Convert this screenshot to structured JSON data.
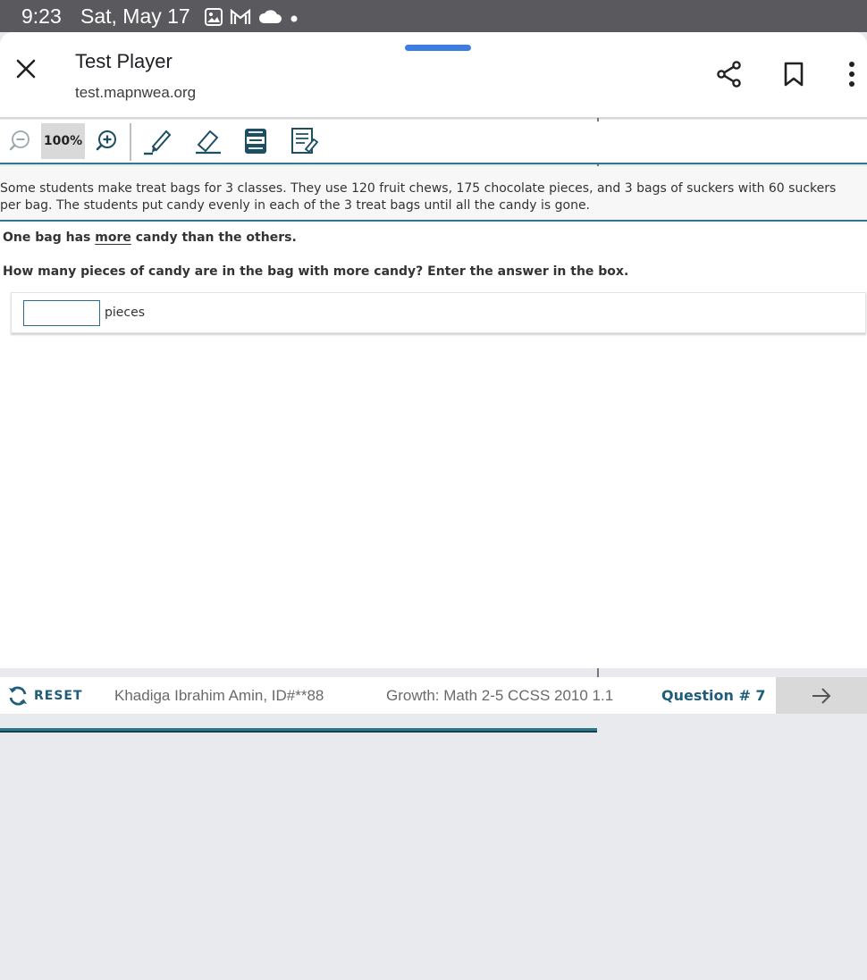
{
  "status_bar": {
    "time": "9:23",
    "date": "Sat, May 17",
    "icons": [
      "image-icon",
      "gmail-icon",
      "cloud-icon",
      "dot-icon"
    ]
  },
  "browser": {
    "title": "Test Player",
    "url": "test.mapnwea.org",
    "accent": "#3d7de0",
    "actions": [
      "share-icon",
      "bookmark-icon",
      "more-vert-icon"
    ]
  },
  "toolbar": {
    "zoom_level": "100%",
    "tools": [
      "zoom-out-icon",
      "zoom-in-icon",
      "highlighter-icon",
      "eraser-icon",
      "line-reader-icon",
      "notepad-icon"
    ]
  },
  "question": {
    "passage": "Some students make treat bags for 3 classes. They use 120 fruit chews, 175 chocolate pieces, and 3 bags of suckers with 60 suckers per bag. The students put candy evenly in each of the 3 treat bags until all the candy is gone.",
    "line1_before": "One bag has ",
    "line1_emphasis": "more",
    "line1_after": " candy than the others.",
    "prompt": "How many pieces of candy are in the bag with more candy? Enter the answer in the box.",
    "answer_value": "",
    "answer_unit": "pieces"
  },
  "footer": {
    "reset_label": "RESET",
    "student": "Khadiga Ibrahim Amin, ID#**88",
    "test_name": "Growth: Math 2-5 CCSS 2010 1.1",
    "question_number": "Question # 7",
    "accent": "#1f5d7a"
  }
}
